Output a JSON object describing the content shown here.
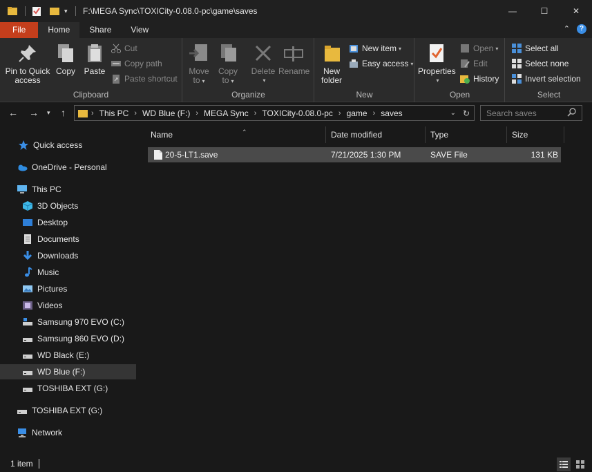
{
  "window": {
    "title": "F:\\MEGA Sync\\TOXICity-0.08.0-pc\\game\\saves",
    "controls": {
      "minimize": "—",
      "maximize": "☐",
      "close": "✕"
    }
  },
  "ribbon_tabs": [
    "File",
    "Home",
    "Share",
    "View"
  ],
  "ribbon": {
    "clipboard": {
      "label": "Clipboard",
      "pin": "Pin to Quick access",
      "pin_l1": "Pin to Quick",
      "pin_l2": "access",
      "copy": "Copy",
      "paste": "Paste",
      "cut": "Cut",
      "copy_path": "Copy path",
      "paste_shortcut": "Paste shortcut"
    },
    "organize": {
      "label": "Organize",
      "move_l1": "Move",
      "move_l2": "to",
      "copy_l1": "Copy",
      "copy_l2": "to",
      "delete": "Delete",
      "rename": "Rename"
    },
    "new": {
      "label": "New",
      "folder_l1": "New",
      "folder_l2": "folder",
      "new_item": "New item",
      "easy_access": "Easy access"
    },
    "open": {
      "label": "Open",
      "properties": "Properties",
      "open": "Open",
      "edit": "Edit",
      "history": "History"
    },
    "select": {
      "label": "Select",
      "select_all": "Select all",
      "select_none": "Select none",
      "invert": "Invert selection"
    }
  },
  "address": {
    "breadcrumbs": [
      "This PC",
      "WD Blue (F:)",
      "MEGA Sync",
      "TOXICity-0.08.0-pc",
      "game",
      "saves"
    ]
  },
  "search": {
    "placeholder": "Search saves"
  },
  "nav": {
    "quick_access": "Quick access",
    "onedrive": "OneDrive - Personal",
    "this_pc": "This PC",
    "objects3d": "3D Objects",
    "desktop": "Desktop",
    "documents": "Documents",
    "downloads": "Downloads",
    "music": "Music",
    "pictures": "Pictures",
    "videos": "Videos",
    "drive_c": "Samsung 970 EVO (C:)",
    "drive_d": "Samsung 860 EVO (D:)",
    "drive_e": "WD Black (E:)",
    "drive_f": "WD Blue (F:)",
    "drive_g": "TOSHIBA EXT (G:)",
    "drive_g2": "TOSHIBA EXT (G:)",
    "network": "Network"
  },
  "columns": {
    "name": "Name",
    "date": "Date modified",
    "type": "Type",
    "size": "Size"
  },
  "files": [
    {
      "name": "20-5-LT1.save",
      "date": "7/21/2025 1:30 PM",
      "type": "SAVE File",
      "size": "131 KB"
    }
  ],
  "status": {
    "count": "1 item"
  },
  "colors": {
    "file_tab": "#c43e1c",
    "background": "#191919",
    "ribbon": "#2b2b2b",
    "selected_row": "#4a4a4a"
  }
}
